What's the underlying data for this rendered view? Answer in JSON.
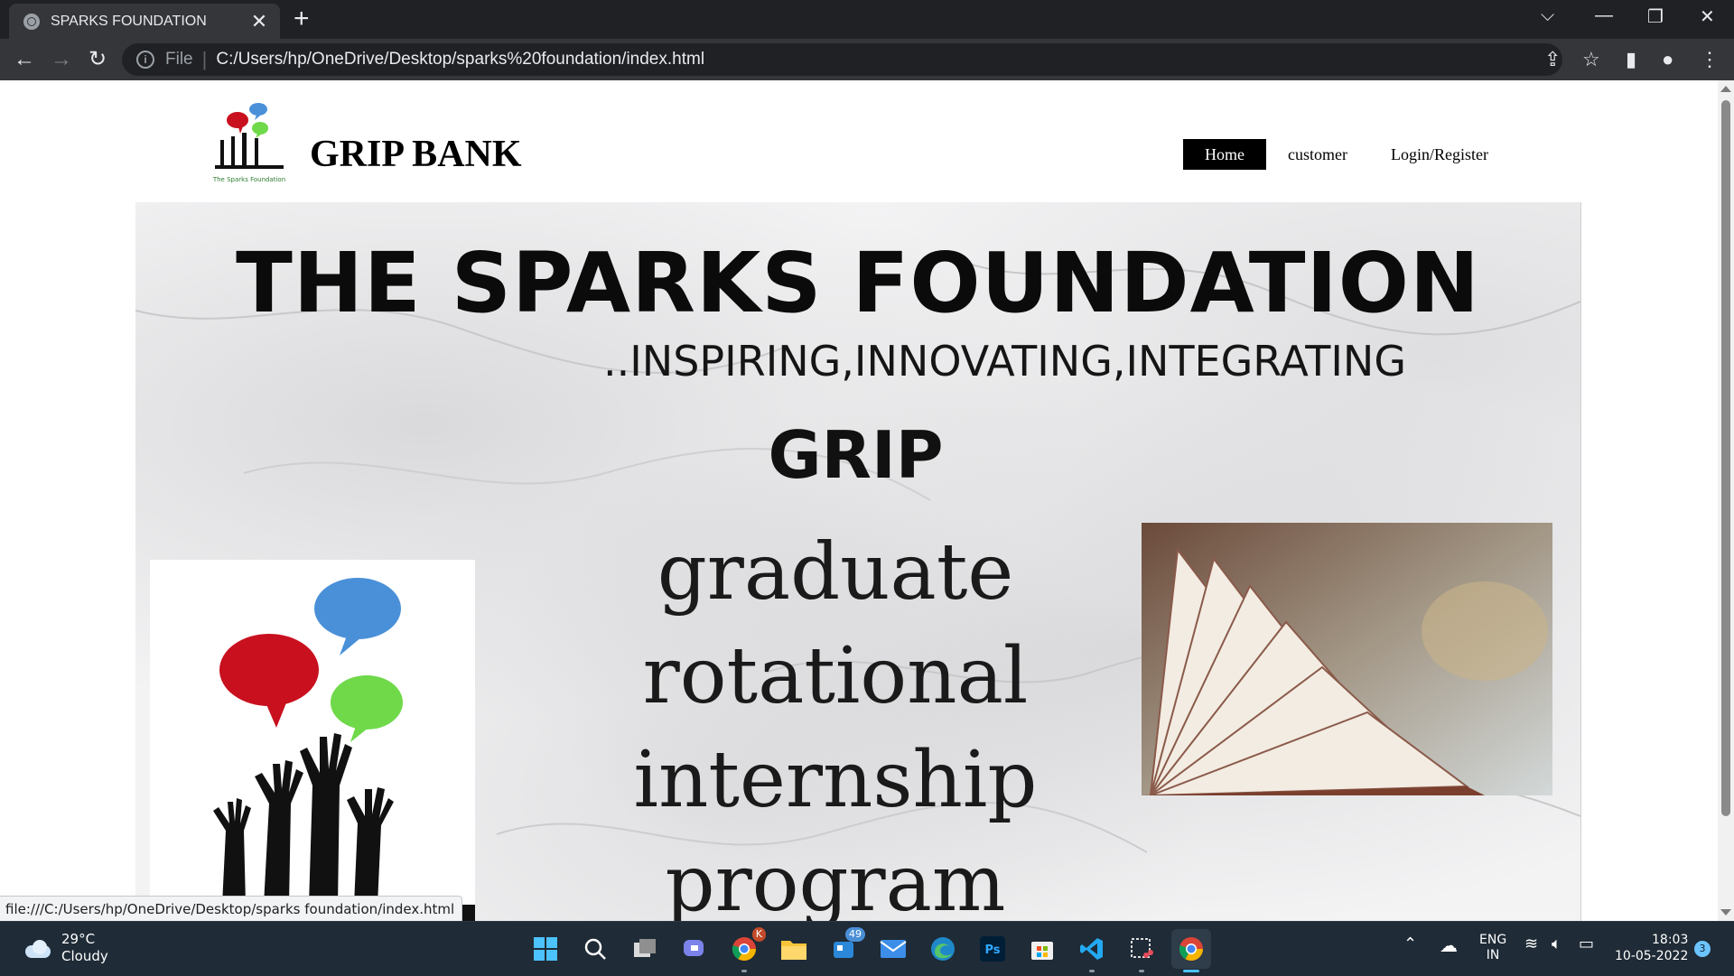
{
  "browser": {
    "tab_title": "SPARKS FOUNDATION",
    "tab_close": "✕",
    "new_tab": "+",
    "address_scheme_label": "File",
    "address_url": "C:/Users/hp/OneDrive/Desktop/sparks%20foundation/index.html",
    "status_url": "file:///C:/Users/hp/OneDrive/Desktop/sparks foundation/index.html"
  },
  "site": {
    "brand": "GRIP BANK",
    "logo_caption": "The Sparks Foundation",
    "nav": [
      "Home",
      "customer",
      "Login/Register"
    ],
    "active_nav": "Home"
  },
  "hero": {
    "title": "THE SPARKS FOUNDATION",
    "tagline": "..INSPIRING,INNOVATING,INTEGRATING",
    "grip": "GRIP",
    "words": [
      "graduate",
      "rotational",
      "internship",
      "program"
    ]
  },
  "taskbar": {
    "temperature": "29°C",
    "condition": "Cloudy",
    "lang_top": "ENG",
    "lang_bottom": "IN",
    "time": "18:03",
    "date": "10-05-2022",
    "notification_count": "3",
    "chrome_profile_badge": "K",
    "mail_badge": "49"
  },
  "colors": {
    "chrome_dark": "#202124",
    "toolbar": "#35363a",
    "taskbar": "#1f2b36",
    "bubble_blue": "#4a90d9",
    "bubble_red": "#c8101e",
    "bubble_green": "#6fd94a"
  }
}
